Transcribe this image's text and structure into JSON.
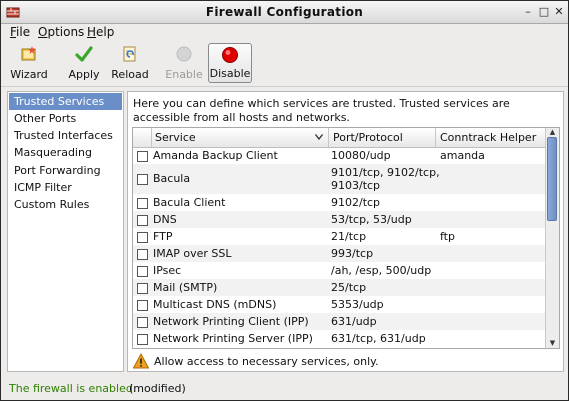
{
  "window": {
    "title": "Firewall Configuration"
  },
  "window_controls": {
    "minimize": "–",
    "maximize": "□",
    "close": "✕"
  },
  "menu": {
    "file": "F",
    "file_rest": "ile",
    "options": "O",
    "options_rest": "ptions",
    "help": "H",
    "help_rest": "elp"
  },
  "toolbar": {
    "wizard": "Wizard",
    "apply": "Apply",
    "reload": "Reload",
    "enable": "Enable",
    "disable": "Disable"
  },
  "sidebar": {
    "items": [
      {
        "label": "Trusted Services"
      },
      {
        "label": "Other Ports"
      },
      {
        "label": "Trusted Interfaces"
      },
      {
        "label": "Masquerading"
      },
      {
        "label": "Port Forwarding"
      },
      {
        "label": "ICMP Filter"
      },
      {
        "label": "Custom Rules"
      }
    ]
  },
  "main": {
    "description": "Here you can define which services are trusted. Trusted services are accessible from all hosts and networks.",
    "columns": {
      "service": "Service",
      "port": "Port/Protocol",
      "helper": "Conntrack Helper"
    },
    "rows": [
      {
        "service": "Amanda Backup Client",
        "port": "10080/udp",
        "helper": "amanda",
        "checked": false
      },
      {
        "service": "Bacula",
        "port": "9101/tcp, 9102/tcp,",
        "port2": "9103/tcp",
        "helper": "",
        "checked": false
      },
      {
        "service": "Bacula Client",
        "port": "9102/tcp",
        "helper": "",
        "checked": false
      },
      {
        "service": "DNS",
        "port": "53/tcp, 53/udp",
        "helper": "",
        "checked": false
      },
      {
        "service": "FTP",
        "port": "21/tcp",
        "helper": "ftp",
        "checked": false
      },
      {
        "service": "IMAP over SSL",
        "port": "993/tcp",
        "helper": "",
        "checked": false
      },
      {
        "service": "IPsec",
        "port": "/ah, /esp, 500/udp",
        "helper": "",
        "checked": false
      },
      {
        "service": "Mail (SMTP)",
        "port": "25/tcp",
        "helper": "",
        "checked": false
      },
      {
        "service": "Multicast DNS (mDNS)",
        "port": "5353/udp",
        "helper": "",
        "checked": false
      },
      {
        "service": "Network Printing Client (IPP)",
        "port": "631/udp",
        "helper": "",
        "checked": false
      },
      {
        "service": "Network Printing Server (IPP)",
        "port": "631/tcp, 631/udp",
        "helper": "",
        "checked": false
      }
    ],
    "hint": "Allow access to necessary services, only."
  },
  "status": {
    "enabled": "The firewall is enabled.",
    "modified": "(modified)"
  },
  "colors": {
    "selection": "#6a8fc8",
    "status_green": "#2f7f00",
    "disable_red": "#e00000"
  }
}
